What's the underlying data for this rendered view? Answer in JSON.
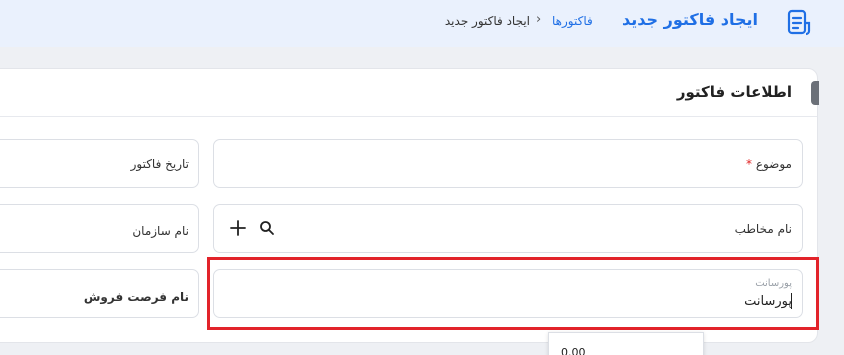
{
  "header": {
    "title": "ایجاد فاکتور جدید",
    "breadcrumb": {
      "parent": "فاکتورها",
      "separator": "›",
      "current": "ایجاد فاکتور جدید"
    },
    "icon": "invoice-icon"
  },
  "card": {
    "title": "اطلاعات فاکتور"
  },
  "fields": {
    "subject": {
      "label": "موضوع",
      "required_mark": "*"
    },
    "invoice_date": {
      "label": "تاریخ فاکتور"
    },
    "contact_name": {
      "label": "نام مخاطب"
    },
    "organization_name": {
      "label": "نام سازمان"
    },
    "commission": {
      "placeholder": "پورسانت",
      "value": "پورسانت"
    },
    "opportunity_name": {
      "label": "نام فرصت فروش"
    }
  },
  "dropdown": {
    "value": "0.00"
  },
  "colors": {
    "accent": "#1f6fe5",
    "header_bg": "#eaf1fd",
    "highlight": "#e2232a",
    "required": "#e02424"
  }
}
